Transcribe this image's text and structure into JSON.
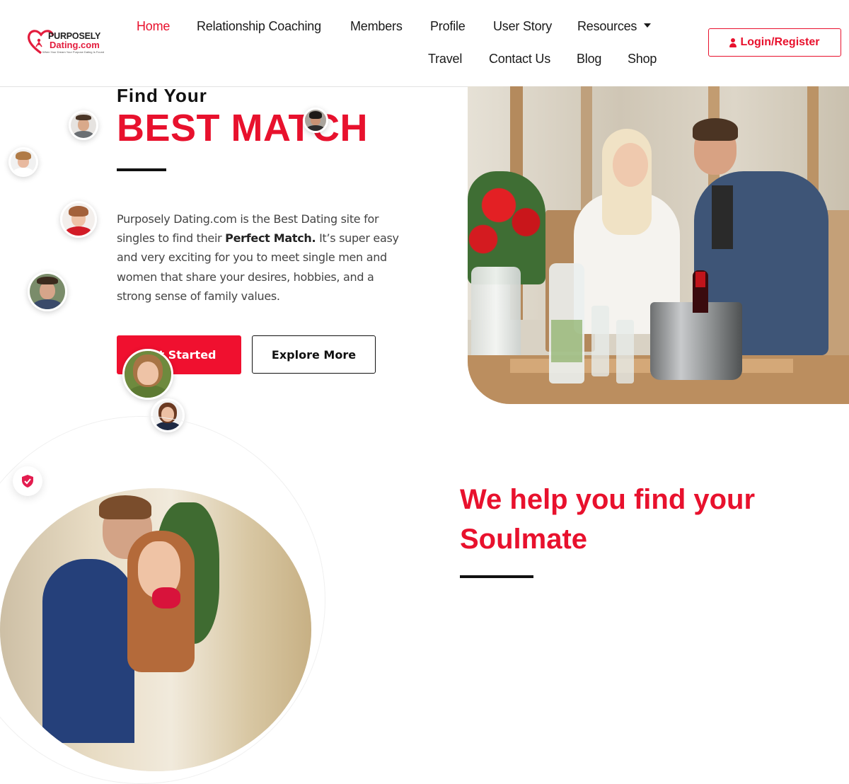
{
  "brand": {
    "name_top": "PURPOSELY",
    "name_bottom": "Dating.com",
    "tagline": "When Your Dream Your Purpose Dating Is Found",
    "accent": "#e8112d"
  },
  "nav": {
    "items": [
      "Home",
      "Relationship Coaching",
      "Members",
      "Profile",
      "User Story",
      "Resources",
      "Travel",
      "Contact Us",
      "Blog",
      "Shop"
    ],
    "active": "Home"
  },
  "login": {
    "label": "Login/Register",
    "icon": "user-icon"
  },
  "hero": {
    "pre_title": "Find Your",
    "title": "BEST MATCH",
    "desc_1": "Purposely Dating.com is the Best Dating site for singles to find their ",
    "desc_bold": "Perfect Match.",
    "desc_2": " It’s super easy and very exciting for you to meet single men and women that share your desires, hobbies, and a strong sense of family values.",
    "primary_button": "Get Started",
    "secondary_button": "Explore More"
  },
  "section2": {
    "heading": "We help you find your Soulmate",
    "badge_icon": "shield-check-icon"
  }
}
